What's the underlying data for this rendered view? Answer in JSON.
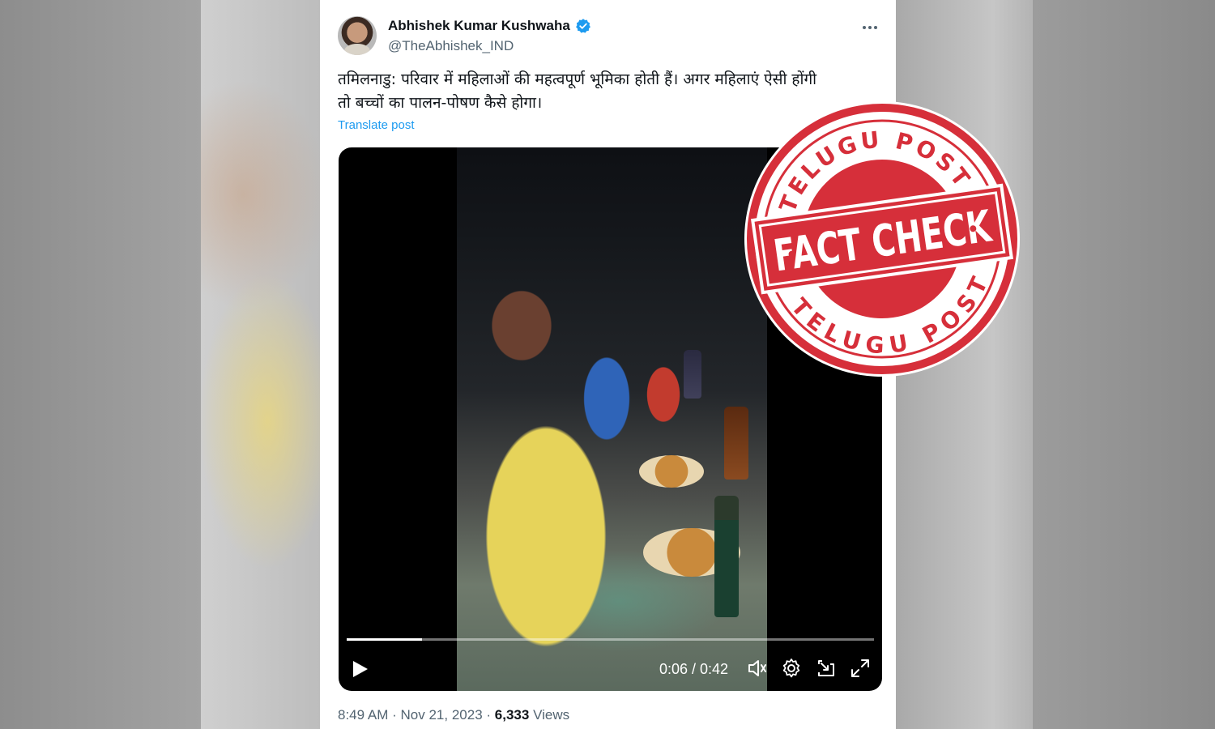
{
  "tweet": {
    "author_name": "Abhishek Kumar Kushwaha",
    "handle": "@TheAbhishek_IND",
    "text_line1": "तमिलनाडु: परिवार में महिलाओं की महत्वपूर्ण भूमिका होती हैं। अगर महिलाएं ऐसी होंगी",
    "text_line2": "तो बच्चों का पालन-पोषण कैसे होगा।",
    "translate_label": "Translate post",
    "time": "8:49 AM",
    "separator": "·",
    "date": "Nov 21, 2023",
    "views_count": "6,333",
    "views_label": "Views"
  },
  "video": {
    "time_display": "0:06 / 0:42",
    "progress": 0.143
  },
  "stamp": {
    "top_text": "TELUGU POST",
    "main_text": "FACT CHECK",
    "bottom_text": "TELUGU POST",
    "color": "#d62f3a"
  },
  "colors": {
    "text_primary": "#0f1419",
    "text_secondary": "#536471",
    "link": "#1d9bf0"
  },
  "icons": [
    "verified-badge-icon",
    "more-options-icon",
    "play-icon",
    "volume-icon",
    "settings-icon",
    "pip-icon",
    "fullscreen-icon"
  ]
}
